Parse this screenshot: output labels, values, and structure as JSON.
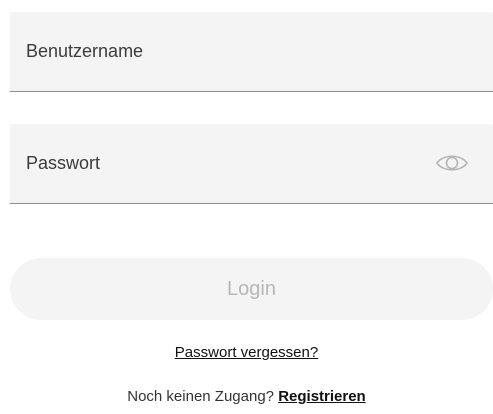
{
  "form": {
    "username": {
      "placeholder": "Benutzername",
      "value": ""
    },
    "password": {
      "placeholder": "Passwort",
      "value": "",
      "toggle_icon": "eye-icon"
    },
    "login_label": "Login",
    "login_enabled": false,
    "forgot_password_label": "Passwort vergessen?",
    "register_prompt": "Noch keinen Zugang?",
    "register_label": "Registrieren"
  },
  "colors": {
    "field_background": "#f4f4f4",
    "field_border": "#8d8d8d",
    "button_background": "#f4f4f4",
    "button_text_disabled": "#b7b7b7",
    "link_text": "#111111"
  }
}
